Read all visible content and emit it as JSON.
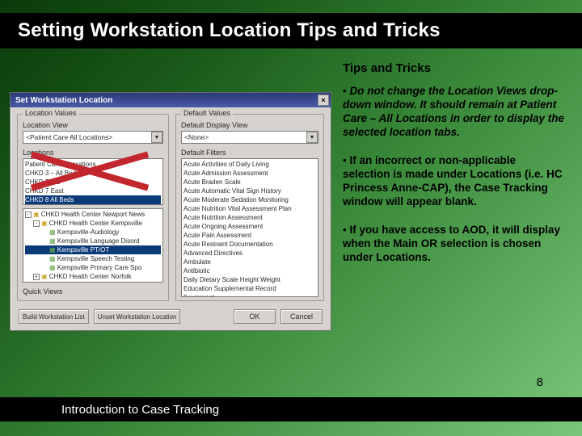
{
  "title": "Setting Workstation Location Tips and Tricks",
  "subtitle": "Tips and Tricks",
  "tips": {
    "p1_a": "Do not change the Location Views drop-down window. It should remain at Patient Care – All Locations in order to display the selected location tabs.",
    "p2_a": "If an incorrect or non-applicable selection is made under Locations (i.e. HC Princess Anne-CAP), the Case Tracking window will appear blank.",
    "p3_a": "If you have access to AOD, it will display when the Main OR selection is chosen under Locations."
  },
  "footer": {
    "text": "Introduction to Case Tracking",
    "page": "8"
  },
  "dialog": {
    "title": "Set Workstation Location",
    "close": "×",
    "left_group": "Location Values",
    "right_group": "Default Values",
    "loc_view_label": "Location View",
    "loc_view_value": "<Patient Care All Locations>",
    "locations_label": "Locations",
    "loc_list": [
      "Patient Care – Locations",
      "CHKD 3 – All Beds",
      "CHKD PICU",
      "CHKD 7 East",
      "CHKD 8 All Beds"
    ],
    "loc_sel_index": 4,
    "tree": [
      {
        "d": 0,
        "exp": "-",
        "ic": "f",
        "t": "CHKD Health Center Newport News"
      },
      {
        "d": 1,
        "exp": "-",
        "ic": "f",
        "t": "CHKD Health Center Kempsville"
      },
      {
        "d": 2,
        "exp": "",
        "ic": "d",
        "t": "Kempsville-Audiology"
      },
      {
        "d": 2,
        "exp": "",
        "ic": "d",
        "t": "Kempsville Language Disord"
      },
      {
        "d": 2,
        "exp": "",
        "ic": "d",
        "t": "Kempsville PT/OT",
        "sel": true
      },
      {
        "d": 2,
        "exp": "",
        "ic": "d",
        "t": "Kempsville Speech Testing"
      },
      {
        "d": 2,
        "exp": "",
        "ic": "d",
        "t": "Kempsville Primary Care Spo"
      },
      {
        "d": 1,
        "exp": "+",
        "ic": "f",
        "t": "CHKD Health Center Norfolk"
      }
    ],
    "quick_label": "Quick Views",
    "def_view_label": "Default Display View",
    "def_view_value": "<None>",
    "filters_label": "Default Filters",
    "filters": [
      "Acute Activities of Daily Living",
      "Acute Admission Assessment",
      "Acute Braden Scale",
      "Acute Automatic Vital Sign History",
      "Acute Moderate Sedation Monitoring",
      "Acute Nutrition Vital Assessment Plan",
      "Acute Nutrition Assessment",
      "Acute Ongoing Assessment",
      "Acute Pain Assessment",
      "Acute Restraint Documentation",
      "Advanced Directives",
      "Ambulate",
      "Antibiotic",
      "Daily Dietary Scale Height Weight",
      "Education Supplemental Record",
      "Equipment"
    ],
    "btn_build": "Build Workstation List",
    "btn_unset": "Unset Workstation Location",
    "btn_ok": "OK",
    "btn_cancel": "Cancel"
  }
}
